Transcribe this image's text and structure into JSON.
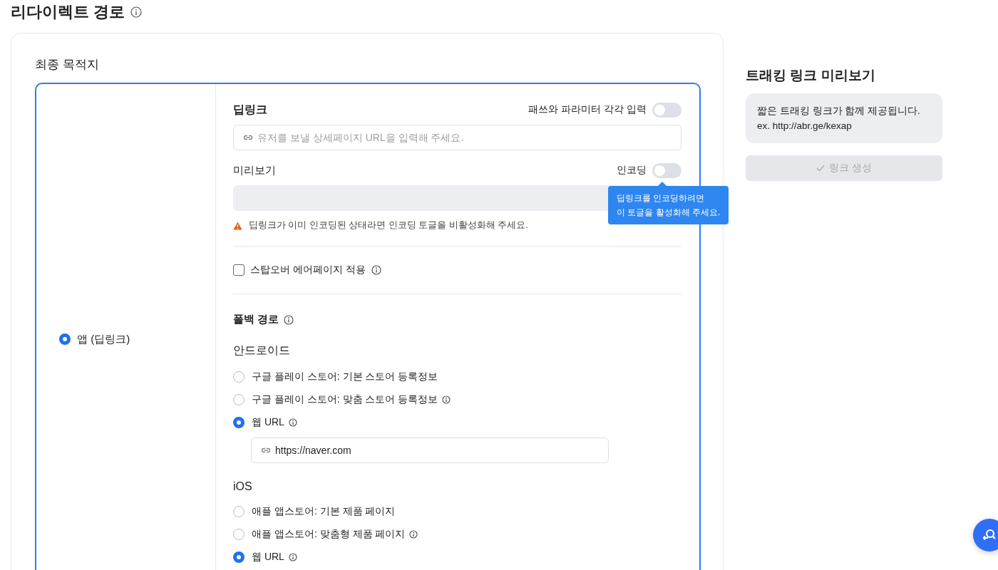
{
  "page_title": "리다이렉트 경로",
  "destination": {
    "label": "최종 목적지",
    "options": [
      {
        "label": "앱 (딥링크)",
        "selected": true
      }
    ],
    "deeplink": {
      "label": "딥링크",
      "toggle": {
        "label": "패쓰와 파라미터 각각 입력",
        "on": false
      },
      "placeholder": "유저를 보낼 상세페이지 URL을 입력해 주세요."
    },
    "preview": {
      "label": "미리보기",
      "toggle": {
        "label": "인코딩",
        "on": false
      },
      "tooltip": "딥링크를 인코딩하려면\n이 토글을 활성화해 주세요.",
      "warning": "딥링크가 이미 인코딩된 상태라면 인코딩 토글을 비활성화해 주세요."
    },
    "stopover": {
      "label": "스탑오버 에어페이지 적용",
      "checked": false
    },
    "fallback": {
      "label": "폴백 경로",
      "groups": [
        {
          "label": "안드로이드",
          "options": [
            {
              "label": "구글 플레이 스토어: 기본 스토어 등록정보",
              "selected": false,
              "info": false
            },
            {
              "label": "구글 플레이 스토어: 맞춤 스토어 등록정보",
              "selected": false,
              "info": true
            },
            {
              "label": "웹 URL",
              "selected": true,
              "info": true,
              "value": "https://naver.com"
            }
          ]
        },
        {
          "label": "iOS",
          "options": [
            {
              "label": "애플 앱스토어: 기본 제품 페이지",
              "selected": false,
              "info": false
            },
            {
              "label": "애플 앱스토어: 맞춤형 제품 페이지",
              "selected": false,
              "info": true
            },
            {
              "label": "웹 URL",
              "selected": true,
              "info": true
            }
          ]
        }
      ]
    }
  },
  "preview_panel": {
    "title": "트래킹 링크 미리보기",
    "note": "짧은 트래킹 링크가 함께 제공됩니다.\nex. http://abr.ge/kexap",
    "button": {
      "label": "링크 생성",
      "disabled": true
    }
  }
}
